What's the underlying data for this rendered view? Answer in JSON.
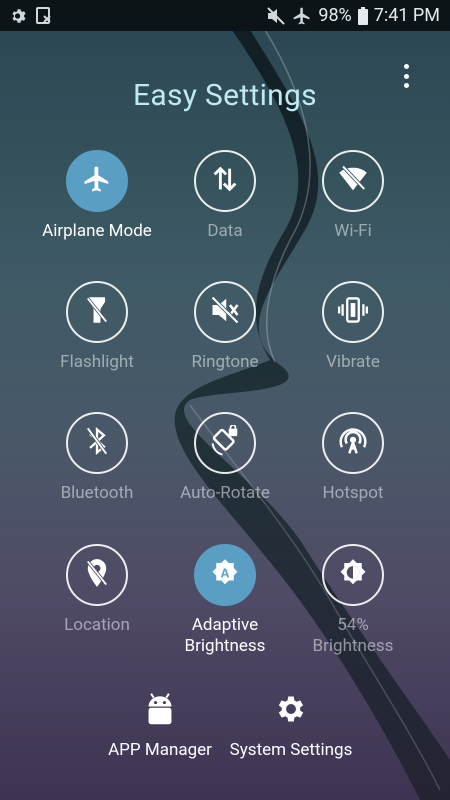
{
  "status_bar": {
    "battery": "98%",
    "time": "7:41 PM"
  },
  "title": "Easy Settings",
  "tiles": [
    {
      "label": "Airplane Mode",
      "icon": "airplane-icon",
      "active": true
    },
    {
      "label": "Data",
      "icon": "data-icon",
      "active": false
    },
    {
      "label": "Wi-Fi",
      "icon": "wifi-off-icon",
      "active": false
    },
    {
      "label": "Flashlight",
      "icon": "flashlight-off-icon",
      "active": false
    },
    {
      "label": "Ringtone",
      "icon": "mute-icon",
      "active": false
    },
    {
      "label": "Vibrate",
      "icon": "vibrate-icon",
      "active": false
    },
    {
      "label": "Bluetooth",
      "icon": "bluetooth-off-icon",
      "active": false
    },
    {
      "label": "Auto-Rotate",
      "icon": "rotate-lock-icon",
      "active": false
    },
    {
      "label": "Hotspot",
      "icon": "hotspot-icon",
      "active": false
    },
    {
      "label": "Location",
      "icon": "location-off-icon",
      "active": false
    },
    {
      "label": "Adaptive Brightness",
      "label_line1": "Adaptive",
      "label_line2": "Brightness",
      "icon": "auto-brightness-icon",
      "active": true
    },
    {
      "label": "54% Brightness",
      "label_line1": "54%",
      "label_line2": "Brightness",
      "icon": "brightness-icon",
      "active": false
    }
  ],
  "bottom": {
    "app_manager": "APP Manager",
    "system_settings": "System Settings"
  },
  "colors": {
    "accent": "#5a9fc3",
    "title": "#bfe9f5",
    "status_bar": "#0d1418"
  }
}
